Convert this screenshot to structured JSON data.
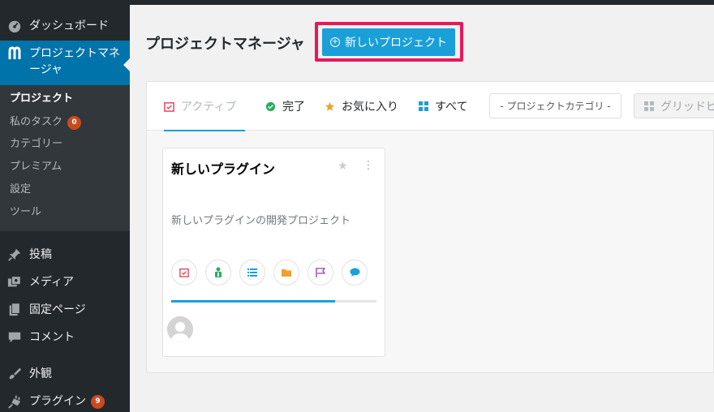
{
  "sidebar": {
    "dashboard": "ダッシュボード",
    "project_manager": "プロジェクトマネージャ",
    "submenu": [
      {
        "label": "プロジェクト"
      },
      {
        "label": "私のタスク",
        "badge": "0"
      },
      {
        "label": "カテゴリー"
      },
      {
        "label": "プレミアム"
      },
      {
        "label": "設定"
      },
      {
        "label": "ツール"
      }
    ],
    "posts": "投稿",
    "media": "メディア",
    "pages": "固定ページ",
    "comments": "コメント",
    "appearance": "外観",
    "plugins": "プラグイン",
    "plugins_badge": "9"
  },
  "header": {
    "title": "プロジェクトマネージャ",
    "new_project_label": "新しいプロジェクト"
  },
  "filters": {
    "tabs": [
      {
        "label": "アクティブ",
        "icon": "calendar-check-icon",
        "color": "#e1475f"
      },
      {
        "label": "完了",
        "icon": "check-circle-icon",
        "color": "#27ae60"
      },
      {
        "label": "お気に入り",
        "icon": "star-icon",
        "color": "#f0a02c"
      },
      {
        "label": "すべて",
        "icon": "grid-icon",
        "color": "#1a9fd8"
      }
    ],
    "category_select": "- プロジェクトカテゴリ -",
    "grid_view": "グリッドビ"
  },
  "project": {
    "title": "新しいプラグイン",
    "description": "新しいプラグインの開発プロジェクト",
    "progress": 80
  },
  "colors": {
    "accent": "#1a9fd8",
    "highlight": "#e8175d",
    "sidebar_bg": "#23282d",
    "sidebar_current": "#0073aa"
  }
}
